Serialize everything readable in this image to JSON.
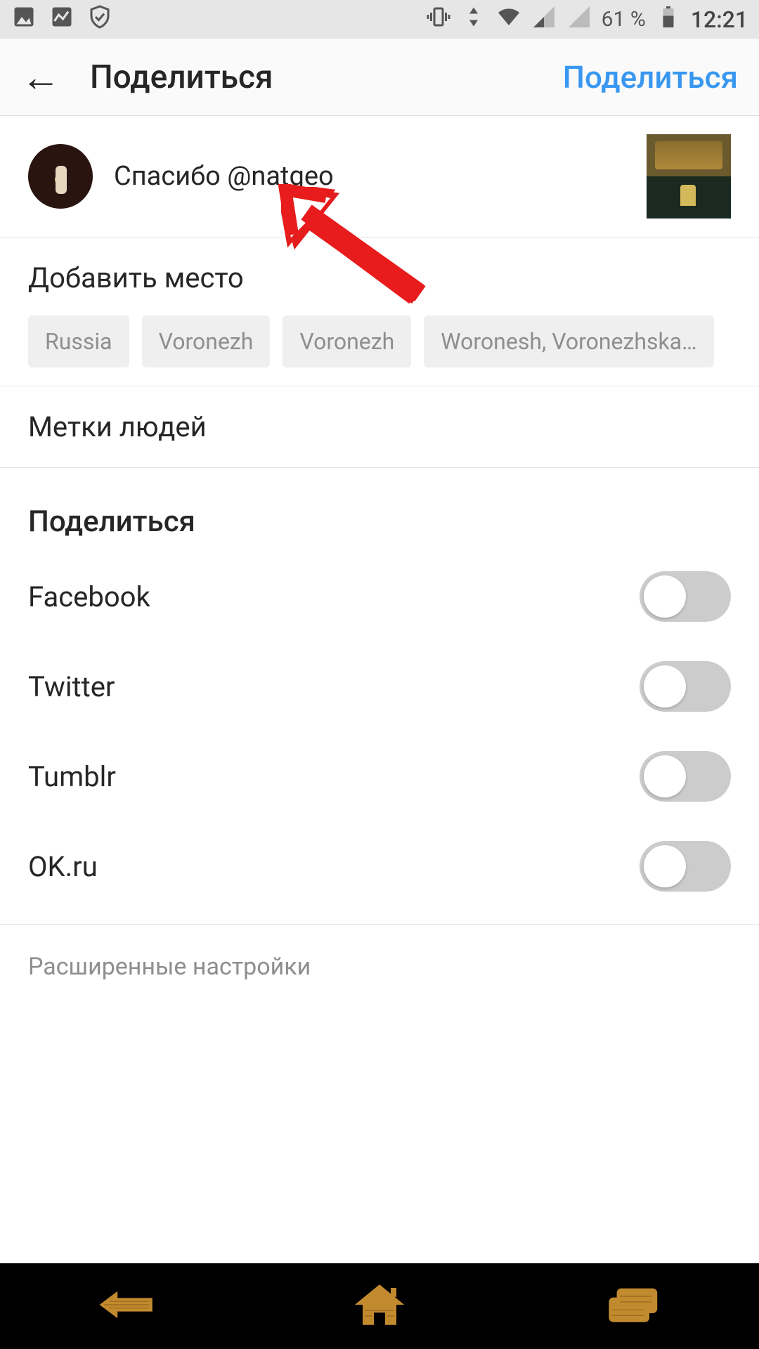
{
  "statusbar": {
    "battery": "61 %",
    "clock": "12:21"
  },
  "appbar": {
    "title": "Поделиться",
    "action": "Поделиться"
  },
  "caption": {
    "text": "Спасибо @natgeo"
  },
  "add_place": {
    "label": "Добавить место"
  },
  "chips": [
    "Russia",
    "Voronezh",
    "Voronezh",
    "Woronesh, Voronezhska…"
  ],
  "tag_people": {
    "label": "Метки людей"
  },
  "share": {
    "title": "Поделиться",
    "items": [
      {
        "label": "Facebook"
      },
      {
        "label": "Twitter"
      },
      {
        "label": "Tumblr"
      },
      {
        "label": "OK.ru"
      }
    ]
  },
  "advanced": {
    "label": "Расширенные настройки"
  }
}
